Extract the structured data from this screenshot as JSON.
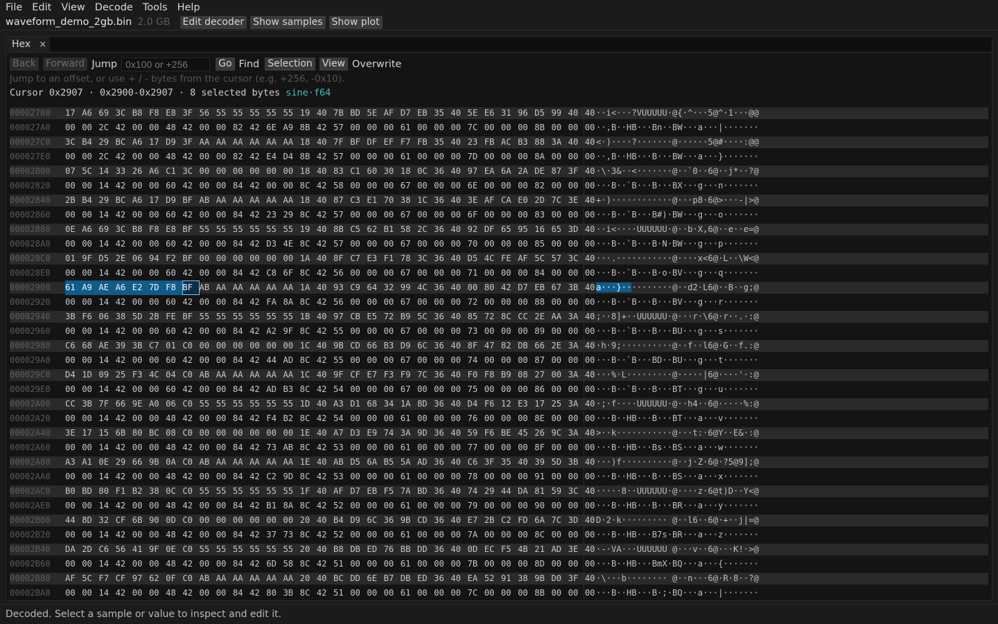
{
  "menu": [
    "File",
    "Edit",
    "View",
    "Decode",
    "Tools",
    "Help"
  ],
  "file": {
    "name": "waveform_demo_2gb.bin",
    "size": "2.0 GB"
  },
  "file_buttons": [
    "Edit decoder",
    "Show samples",
    "Show plot"
  ],
  "tab": {
    "label": "Hex",
    "close": "×"
  },
  "toolbar": {
    "back": "Back",
    "forward": "Forward",
    "jump_label": "Jump",
    "jump_placeholder": "0x100 or +256",
    "go": "Go",
    "find": "Find",
    "selection": "Selection",
    "view": "View",
    "overwrite": "Overwrite"
  },
  "hint": "Jump to an offset, or use + / - bytes from the cursor (e.g. +256, -0x10).",
  "cursor_info": {
    "text": "Cursor 0x2907 · 0x2900-0x2907 · 8 selected bytes ",
    "dtype": "sine·f64"
  },
  "selection": {
    "row": 12,
    "start": 0,
    "end": 7,
    "cursor_byte": 7,
    "ascii_selected": "a···}··"
  },
  "rows": [
    {
      "addr": "00002780",
      "hex": "17 A6 69 3C B8 F8 E8 3F 56 55 55 55 55 55 19 40 7B BD 5E AF D7 EB 35 40 5E E6 31 96 D5 99 40 40",
      "ascii": "··i<···?VUUUUU·@{·^···5@^·1···@@"
    },
    {
      "addr": "000027A0",
      "hex": "00 00 2C 42 00 00 48 42 00 00 82 42 6E A9 8B 42 57 00 00 00 61 00 00 00 7C 00 00 00 8B 00 00 00",
      "ascii": "··,B··HB···Bn··BW···a···|·······"
    },
    {
      "addr": "000027C0",
      "hex": "3C B4 29 BC A6 17 D9 3F AA AA AA AA AA AA 18 40 7F BF DF EF F7 FB 35 40 23 FB AC B3 88 3A 40 40",
      "ascii": "<·)····?·······@······5@#····:@@"
    },
    {
      "addr": "000027E0",
      "hex": "00 00 2C 42 00 00 48 42 00 00 82 42 E4 D4 8B 42 57 00 00 00 61 00 00 00 7D 00 00 00 8A 00 00 00",
      "ascii": "··,B··HB···B···BW···a···}·······"
    },
    {
      "addr": "00002800",
      "hex": "07 5C 14 33 26 A6 C1 3C 00 00 00 00 00 00 18 40 83 C1 60 30 18 0C 36 40 97 EA 6A 2A DE 87 3F 40",
      "ascii": "·\\·3&··<·······@··`0··6@··j*··?@"
    },
    {
      "addr": "00002820",
      "hex": "00 00 14 42 00 00 60 42 00 00 84 42 00 00 8C 42 58 00 00 00 67 00 00 00 6E 00 00 00 82 00 00 00",
      "ascii": "···B··`B···B···BX···g···n·······"
    },
    {
      "addr": "00002840",
      "hex": "2B B4 29 BC A6 17 D9 BF AB AA AA AA AA AA 18 40 87 C3 E1 70 38 1C 36 40 3E AF CA E0 2D 7C 3E 40",
      "ascii": "+·)············@···p8·6@>···-|>@"
    },
    {
      "addr": "00002860",
      "hex": "00 00 14 42 00 00 60 42 00 00 84 42 23 29 8C 42 57 00 00 00 67 00 00 00 6F 00 00 00 83 00 00 00",
      "ascii": "···B··`B···B#)·BW···g···o·······"
    },
    {
      "addr": "00002880",
      "hex": "0E A6 69 3C B8 F8 E8 BF 55 55 55 55 55 55 19 40 8B C5 62 B1 58 2C 36 40 92 DF 65 95 16 65 3D 40",
      "ascii": "··i<····UUUUUU·@··b·X,6@··e··e=@"
    },
    {
      "addr": "000028A0",
      "hex": "00 00 14 42 00 00 60 42 00 00 84 42 D3 4E 8C 42 57 00 00 00 67 00 00 00 70 00 00 00 85 00 00 00",
      "ascii": "···B··`B···B·N·BW···g···p·······"
    },
    {
      "addr": "000028C0",
      "hex": "01 9F D5 2E 06 94 F2 BF 00 00 00 00 00 00 1A 40 8F C7 E3 F1 78 3C 36 40 D5 4C FE AF 5C 57 3C 40",
      "ascii": "···.···········@····x<6@·L··\\W<@"
    },
    {
      "addr": "000028E0",
      "hex": "00 00 14 42 00 00 60 42 00 00 84 42 C8 6F 8C 42 56 00 00 00 67 00 00 00 71 00 00 00 84 00 00 00",
      "ascii": "···B··`B···B·o·BV···g···q·······"
    },
    {
      "addr": "00002900",
      "hex": "61 A9 AE A6 E2 7D F8 BF AB AA AA AA AA AA 1A 40 93 C9 64 32 99 4C 36 40 00 80 42 D7 EB 67 3B 40",
      "ascii": "········@··d2·L6@··B··g;@"
    },
    {
      "addr": "00002920",
      "hex": "00 00 14 42 00 00 60 42 00 00 84 42 FA 8A 8C 42 56 00 00 00 67 00 00 00 72 00 00 00 88 00 00 00",
      "ascii": "···B··`B···B···BV···g···r·······"
    },
    {
      "addr": "00002940",
      "hex": "3B F6 06 38 5D 2B FE BF 55 55 55 55 55 55 1B 40 97 CB E5 72 B9 5C 36 40 85 72 8C CC 2E AA 3A 40",
      "ascii": ";··8]+··UUUUUU·@···r·\\6@·r··.·:@"
    },
    {
      "addr": "00002960",
      "hex": "00 00 14 42 00 00 60 42 00 00 84 42 A2 9F 8C 42 55 00 00 00 67 00 00 00 73 00 00 00 89 00 00 00",
      "ascii": "···B··`B···B···BU···g···s·······"
    },
    {
      "addr": "00002980",
      "hex": "C6 68 AE 39 3B C7 01 C0 00 00 00 00 00 00 1C 40 9B CD 66 B3 D9 6C 36 40 8F 47 82 DB 66 2E 3A 40",
      "ascii": "·h·9;··········@··f··l6@·G··f.:@"
    },
    {
      "addr": "000029A0",
      "hex": "00 00 14 42 00 00 60 42 00 00 84 42 44 AD 8C 42 55 00 00 00 67 00 00 00 74 00 00 00 87 00 00 00",
      "ascii": "···B··`B···BD··BU···g···t·······"
    },
    {
      "addr": "000029C0",
      "hex": "D4 1D 09 25 F3 4C 04 C0 AB AA AA AA AA AA 1C 40 9F CF E7 F3 F9 7C 36 40 F0 F8 B9 08 27 00 3A 40",
      "ascii": "···%·L·········@·····|6@····'·:@"
    },
    {
      "addr": "000029E0",
      "hex": "00 00 14 42 00 00 60 42 00 00 84 42 AD B3 8C 42 54 00 00 00 67 00 00 00 75 00 00 00 86 00 00 00",
      "ascii": "···B··`B···B···BT···g···u·······"
    },
    {
      "addr": "00002A00",
      "hex": "CC 3B 7F 66 9E A0 06 C0 55 55 55 55 55 55 1D 40 A3 D1 68 34 1A 8D 36 40 D4 F6 12 E3 17 25 3A 40",
      "ascii": "·;·f····UUUUUU·@··h4··6@·····%:@"
    },
    {
      "addr": "00002A20",
      "hex": "00 00 14 42 00 00 48 42 00 00 84 42 F4 B2 8C 42 54 00 00 00 61 00 00 00 76 00 00 00 8E 00 00 00",
      "ascii": "···B··HB···B···BT···a···v·······"
    },
    {
      "addr": "00002A40",
      "hex": "3E 17 15 6B 80 BC 08 C0 00 00 00 00 00 00 1E 40 A7 D3 E9 74 3A 9D 36 40 59 F6 BE 45 26 9C 3A 40",
      "ascii": ">··k···········@···t:·6@Y··E&·:@"
    },
    {
      "addr": "00002A60",
      "hex": "00 00 14 42 00 00 48 42 00 00 84 42 73 AB 8C 42 53 00 00 00 61 00 00 00 77 00 00 00 8F 00 00 00",
      "ascii": "···B··HB···Bs··BS···a···w·······"
    },
    {
      "addr": "00002A80",
      "hex": "A3 A1 0E 29 66 9B 0A C0 AB AA AA AA AA AA 1E 40 AB D5 6A B5 5A AD 36 40 C6 3F 35 40 39 5D 3B 40",
      "ascii": "···)f··········@··j·Z·6@·?5@9];@"
    },
    {
      "addr": "00002AA0",
      "hex": "00 00 14 42 00 00 48 42 00 00 84 42 C2 9D 8C 42 53 00 00 00 61 00 00 00 78 00 00 00 91 00 00 00",
      "ascii": "···B··HB···B···BS···a···x·······"
    },
    {
      "addr": "00002AC0",
      "hex": "B0 BD 80 F1 B2 38 0C C0 55 55 55 55 55 55 1F 40 AF D7 EB F5 7A BD 36 40 74 29 44 DA 81 59 3C 40",
      "ascii": "·····8··UUUUUU·@····z·6@t)D··Y<@"
    },
    {
      "addr": "00002AE0",
      "hex": "00 00 14 42 00 00 48 42 00 00 84 42 B1 8A 8C 42 52 00 00 00 61 00 00 00 79 00 00 00 90 00 00 00",
      "ascii": "···B··HB···B···BR···a···y·······"
    },
    {
      "addr": "00002B00",
      "hex": "44 8D 32 CF 6B 90 0D C0 00 00 00 00 00 00 20 40 B4 D9 6C 36 9B CD 36 40 E7 2B C2 FD 6A 7C 3D 40",
      "ascii": "D·2·k········· @··l6··6@·+··j|=@"
    },
    {
      "addr": "00002B20",
      "hex": "00 00 14 42 00 00 48 42 00 00 84 42 37 73 8C 42 52 00 00 00 61 00 00 00 7A 00 00 00 8C 00 00 00",
      "ascii": "···B··HB···B7s·BR···a···z·······"
    },
    {
      "addr": "00002B40",
      "hex": "DA 2D C6 56 41 9F 0E C0 55 55 55 55 55 55 20 40 B8 DB ED 76 BB DD 36 40 0D EC F5 4B 21 AD 3E 40",
      "ascii": "·-·VA···UUUUUU @···v··6@···K!·>@"
    },
    {
      "addr": "00002B60",
      "hex": "00 00 14 42 00 00 48 42 00 00 84 42 6D 58 8C 42 51 00 00 00 61 00 00 00 7B 00 00 00 8D 00 00 00",
      "ascii": "···B··HB···BmX·BQ···a···{·······"
    },
    {
      "addr": "00002B80",
      "hex": "AF 5C F7 CF 97 62 0F C0 AB AA AA AA AA AA 20 40 BC DD 6E B7 DB ED 36 40 EA 52 91 38 9B D0 3F 40",
      "ascii": "·\\···b········ @··n···6@·R·8··?@"
    },
    {
      "addr": "00002BA0",
      "hex": "00 00 14 42 00 00 48 42 00 00 84 42 80 3B 8C 42 51 00 00 00 61 00 00 00 7C 00 00 00 8B 00 00 00",
      "ascii": "···B··HB···B·;·BQ···a···|·······"
    }
  ],
  "status": "Decoded. Select a sample or value to inspect and edit it."
}
